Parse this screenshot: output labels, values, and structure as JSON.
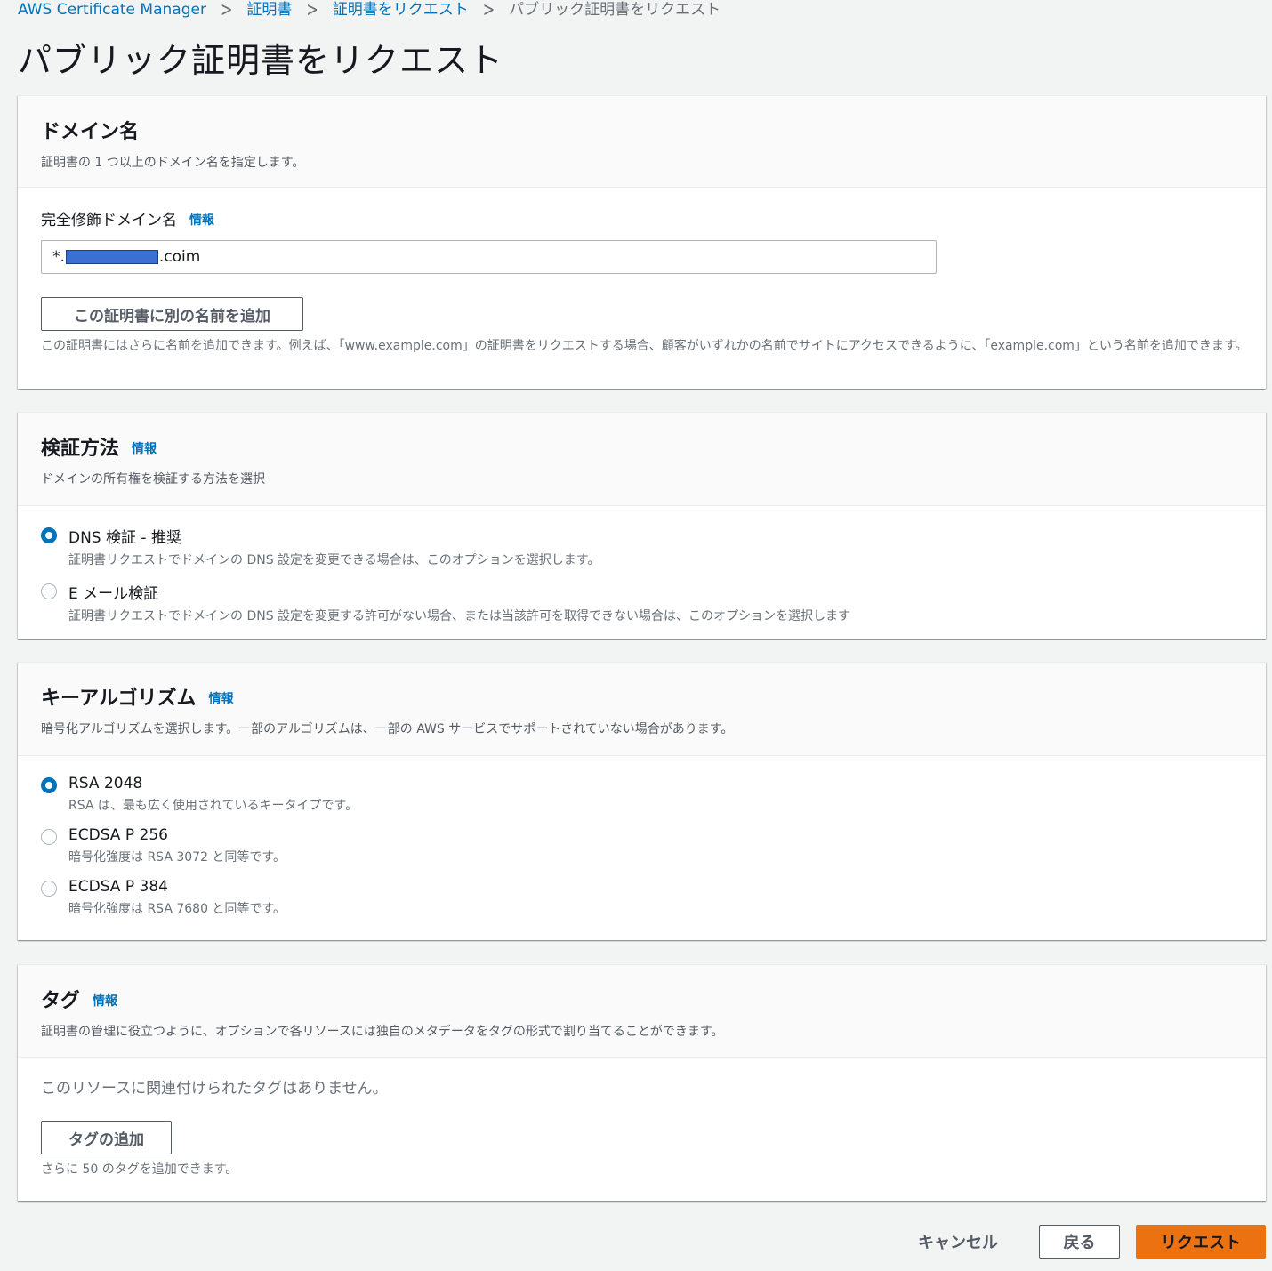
{
  "breadcrumb": {
    "items": [
      "AWS Certificate Manager",
      "証明書",
      "証明書をリクエスト",
      "パブリック証明書をリクエスト"
    ]
  },
  "page": {
    "title": "パブリック証明書をリクエスト"
  },
  "domain_panel": {
    "title": "ドメイン名",
    "description": "証明書の 1 つ以上のドメイン名を指定します。",
    "field_label": "完全修飾ドメイン名",
    "info": "情報",
    "value_prefix": "*.",
    "value_suffix": ".coim",
    "add_name_button": "この証明書に別の名前を追加",
    "helper": "この証明書にはさらに名前を追加できます。例えば、「www.example.com」の証明書をリクエストする場合、顧客がいずれかの名前でサイトにアクセスできるように、「example.com」という名前を追加できます。"
  },
  "validation_panel": {
    "title": "検証方法",
    "info": "情報",
    "description": "ドメインの所有権を検証する方法を選択",
    "options": [
      {
        "label": "DNS 検証 - 推奨",
        "desc": "証明書リクエストでドメインの DNS 設定を変更できる場合は、このオプションを選択します。",
        "checked": true
      },
      {
        "label": "E メール検証",
        "desc": "証明書リクエストでドメインの DNS 設定を変更する許可がない場合、または当該許可を取得できない場合は、このオプションを選択します",
        "checked": false
      }
    ]
  },
  "key_panel": {
    "title": "キーアルゴリズム",
    "info": "情報",
    "description": "暗号化アルゴリズムを選択します。一部のアルゴリズムは、一部の AWS サービスでサポートされていない場合があります。",
    "options": [
      {
        "label": "RSA 2048",
        "desc": "RSA は、最も広く使用されているキータイプです。",
        "checked": true
      },
      {
        "label": "ECDSA P 256",
        "desc": "暗号化強度は RSA 3072 と同等です。",
        "checked": false
      },
      {
        "label": "ECDSA P 384",
        "desc": "暗号化強度は RSA 7680 と同等です。",
        "checked": false
      }
    ]
  },
  "tags_panel": {
    "title": "タグ",
    "info": "情報",
    "description": "証明書の管理に役立つように、オプションで各リソースには独自のメタデータをタグの形式で割り当てることができます。",
    "empty": "このリソースに関連付けられたタグはありません。",
    "add_button": "タグの追加",
    "helper": "さらに 50 のタグを追加できます。"
  },
  "footer": {
    "cancel": "キャンセル",
    "back": "戻る",
    "request": "リクエスト"
  },
  "colors": {
    "link": "#0073bb",
    "primary": "#ec7211",
    "background": "#f2f3f3"
  }
}
